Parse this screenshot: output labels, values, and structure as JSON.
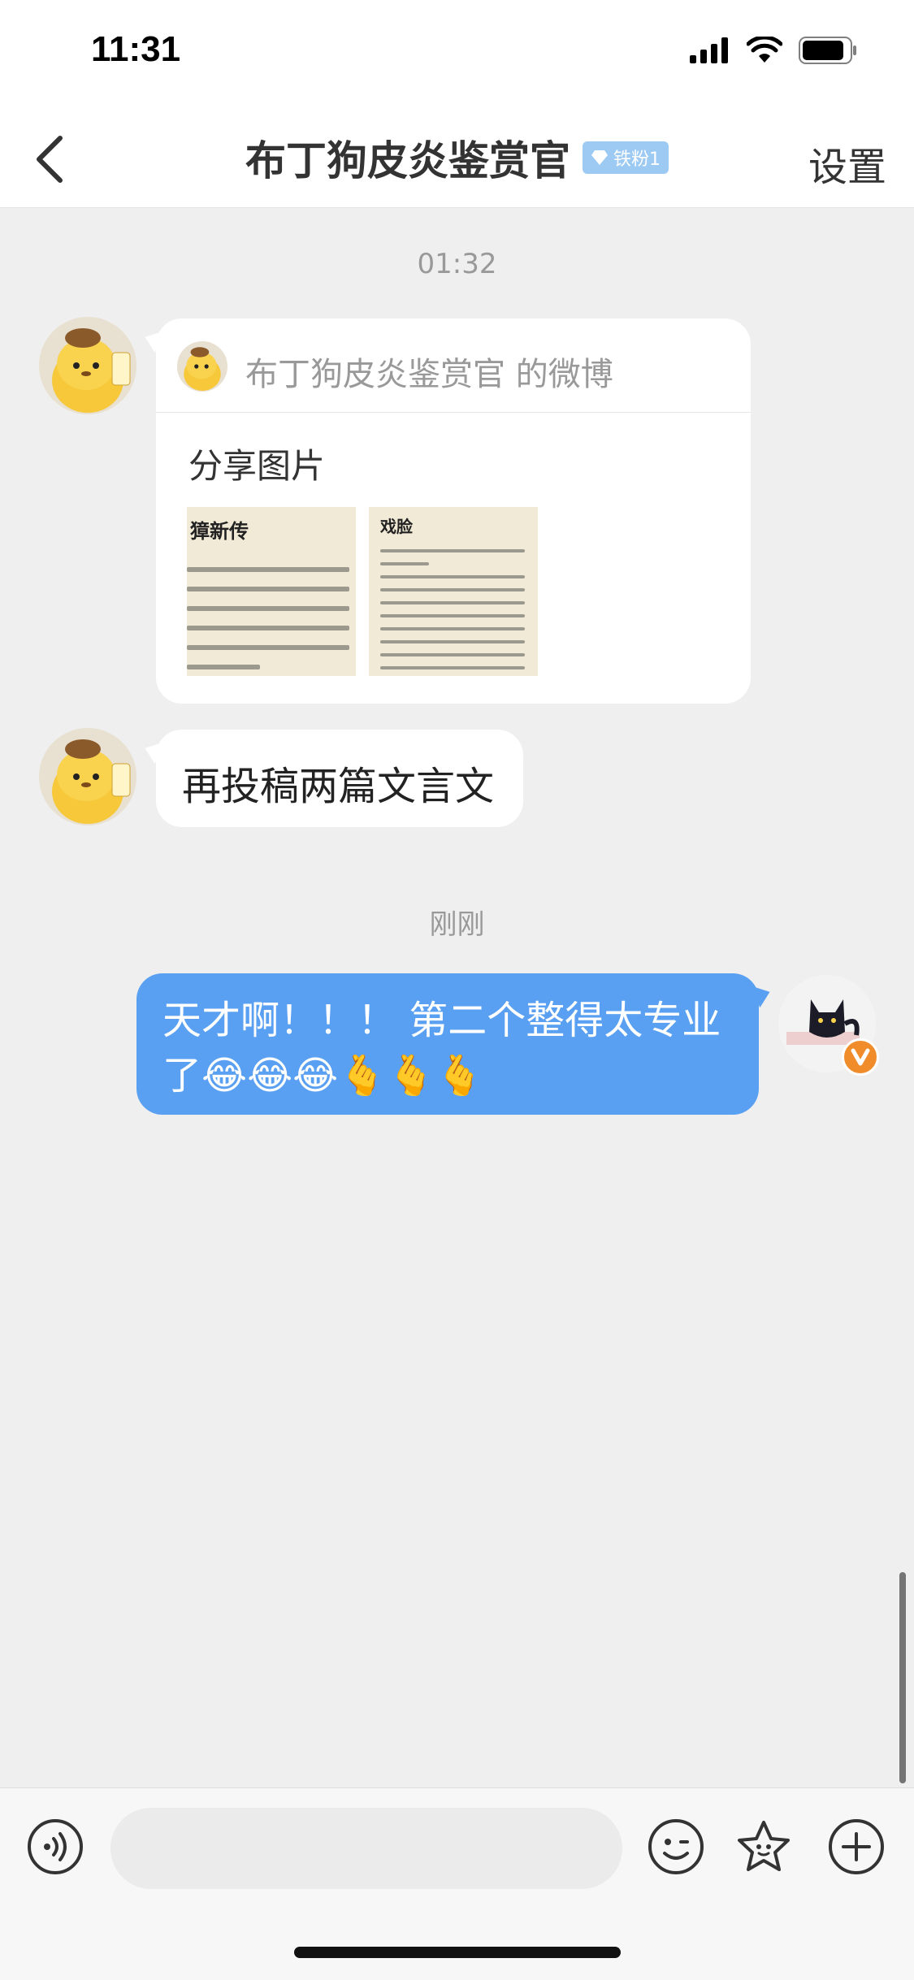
{
  "status_bar": {
    "time": "11:31"
  },
  "nav": {
    "title": "布丁狗皮炎鉴赏官",
    "badge": "铁粉1",
    "settings": "设置"
  },
  "messages": {
    "ts1": "01:32",
    "card": {
      "header": "布丁狗皮炎鉴赏官 的微博",
      "title": "分享图片",
      "thumb1_title": "獐新传",
      "thumb2_title": "戏脸"
    },
    "msg1": "再投稿两篇文言文",
    "ts2": "刚刚",
    "my_msg": "天才啊！！！ 第二个整得太专业了😂😂😂🫰🫰🫰"
  },
  "input": {
    "placeholder": ""
  },
  "colors": {
    "my_bubble": "#5aa0f2",
    "background": "#efefef"
  }
}
